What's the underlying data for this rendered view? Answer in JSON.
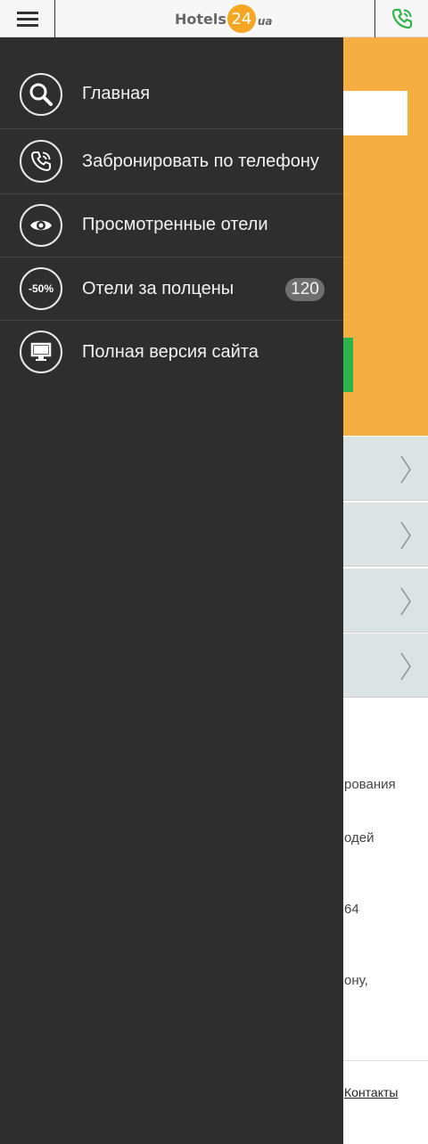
{
  "header": {
    "logo_text": "Hotels",
    "logo_number": "24",
    "logo_suffix": "ua",
    "menu_icon": "hamburger-icon",
    "phone_icon": "phone-icon"
  },
  "drawer": {
    "items": [
      {
        "label": "Главная",
        "icon": "search-icon"
      },
      {
        "label": "Забронировать по телефону",
        "icon": "phone-call-icon"
      },
      {
        "label": "Просмотренные отели",
        "icon": "eye-icon"
      },
      {
        "label": "Отели за полцены",
        "icon": "discount-icon",
        "icon_text": "-50%",
        "badge": "120"
      },
      {
        "label": "Полная версия сайта",
        "icon": "monitor-icon"
      }
    ]
  },
  "background": {
    "text_lines": [
      "рования",
      "одей",
      "64",
      "ону,"
    ],
    "footer_link": "Контакты"
  },
  "colors": {
    "drawer_bg": "#2e2e2e",
    "accent_orange": "#f4ae42",
    "accent_green": "#2db34a",
    "header_bg": "#f7f7f7"
  }
}
